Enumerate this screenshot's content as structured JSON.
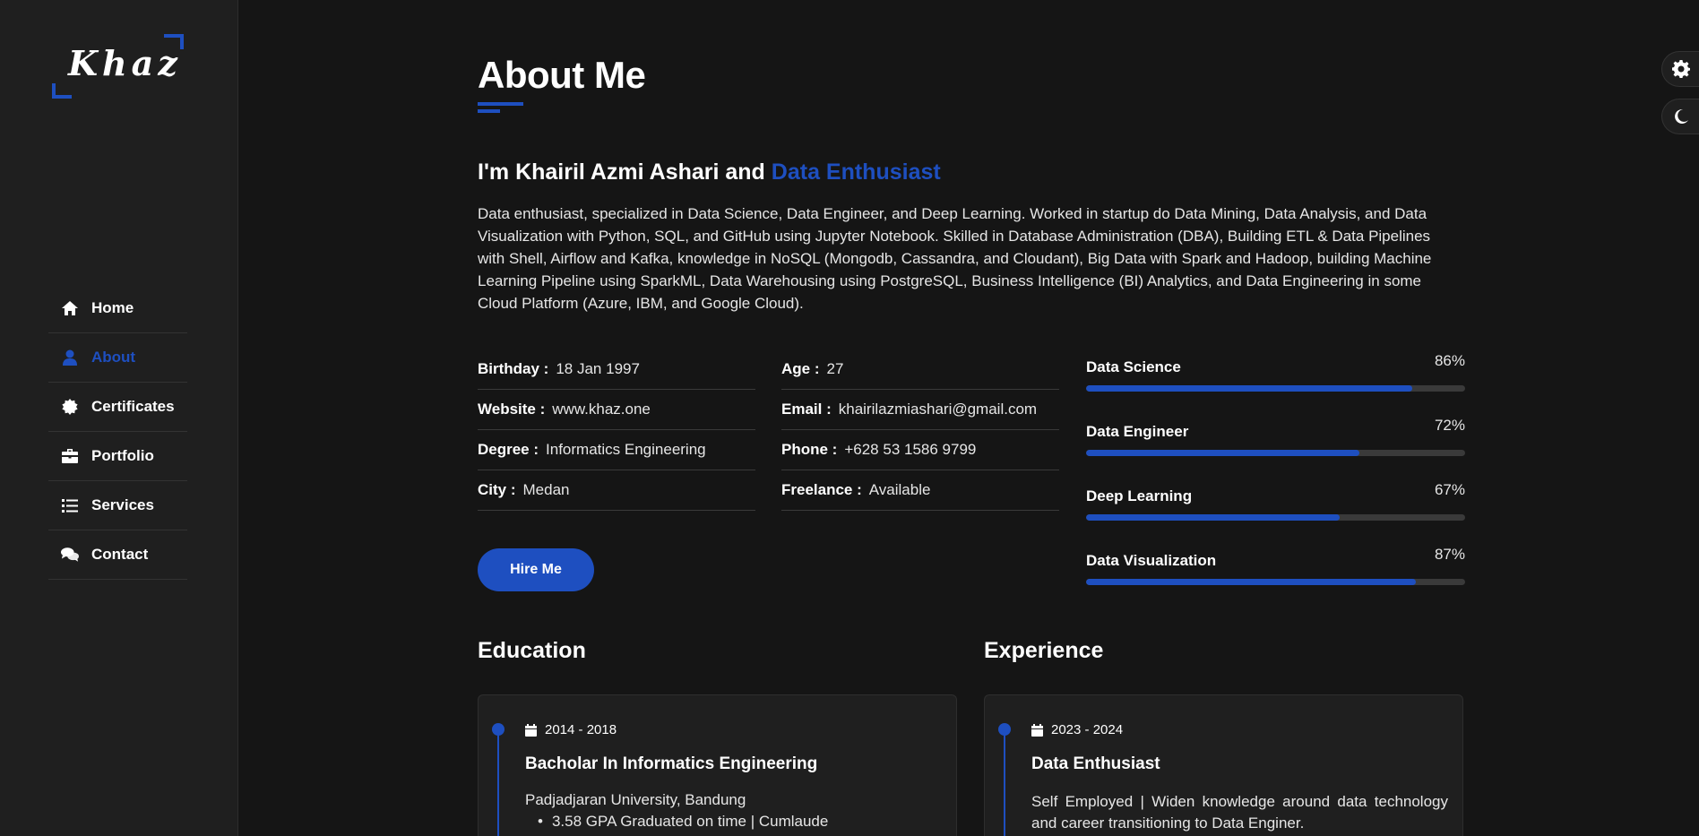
{
  "sidebar": {
    "logo": "Khaz",
    "nav": [
      {
        "label": "Home",
        "icon": "home-icon"
      },
      {
        "label": "About",
        "icon": "user-icon",
        "active": true
      },
      {
        "label": "Certificates",
        "icon": "certificate-icon"
      },
      {
        "label": "Portfolio",
        "icon": "briefcase-icon"
      },
      {
        "label": "Services",
        "icon": "list-icon"
      },
      {
        "label": "Contact",
        "icon": "comments-icon"
      }
    ]
  },
  "about": {
    "title": "About Me",
    "intro_prefix": "I'm Khairil Azmi Ashari and ",
    "intro_accent": "Data Enthusiast",
    "bio": "Data enthusiast, specialized in Data Science, Data Engineer, and Deep Learning. Worked in startup do Data Mining, Data Analysis, and Data Visualization with Python, SQL, and GitHub using Jupyter Notebook. Skilled in Database Administration (DBA), Building ETL & Data Pipelines with Shell, Airflow and Kafka, knowledge in NoSQL (Mongodb, Cassandra, and Cloudant), Big Data with Spark and Hadoop, building Machine Learning Pipeline using SparkML, Data Warehousing using PostgreSQL, Business Intelligence (BI) Analytics, and Data Engineering in some Cloud Platform (Azure, IBM, and Google Cloud).",
    "info_left": [
      {
        "label": "Birthday :",
        "value": "18 Jan 1997"
      },
      {
        "label": "Website :",
        "value": "www.khaz.one"
      },
      {
        "label": "Degree :",
        "value": "Informatics Engineering"
      },
      {
        "label": "City :",
        "value": "Medan"
      }
    ],
    "info_right": [
      {
        "label": "Age :",
        "value": "27"
      },
      {
        "label": "Email :",
        "value": "khairilazmiashari@gmail.com"
      },
      {
        "label": "Phone :",
        "value": "+628 53 1586 9799"
      },
      {
        "label": "Freelance :",
        "value": "Available"
      }
    ],
    "skills": [
      {
        "name": "Data Science",
        "percent_label": "86%",
        "percent": 86
      },
      {
        "name": "Data Engineer",
        "percent_label": "72%",
        "percent": 72
      },
      {
        "name": "Deep Learning",
        "percent_label": "67%",
        "percent": 67
      },
      {
        "name": "Data Visualization",
        "percent_label": "87%",
        "percent": 87
      }
    ],
    "hire_button": "Hire Me"
  },
  "education": {
    "title": "Education",
    "period": "2014 - 2018",
    "degree": "Bacholar In Informatics Engineering",
    "school": "Padjadjaran University, Bandung",
    "points": [
      "3.58 GPA Graduated on time | Cumlaude"
    ]
  },
  "experience": {
    "title": "Experience",
    "period": "2023 - 2024",
    "role": "Data Enthusiast",
    "description": "Self Employed | Widen knowledge around data technology and career transitioning to Data Enginer."
  },
  "colors": {
    "accent": "#1e4fc0",
    "background": "#151515",
    "sidebar": "#1f1f1f"
  }
}
